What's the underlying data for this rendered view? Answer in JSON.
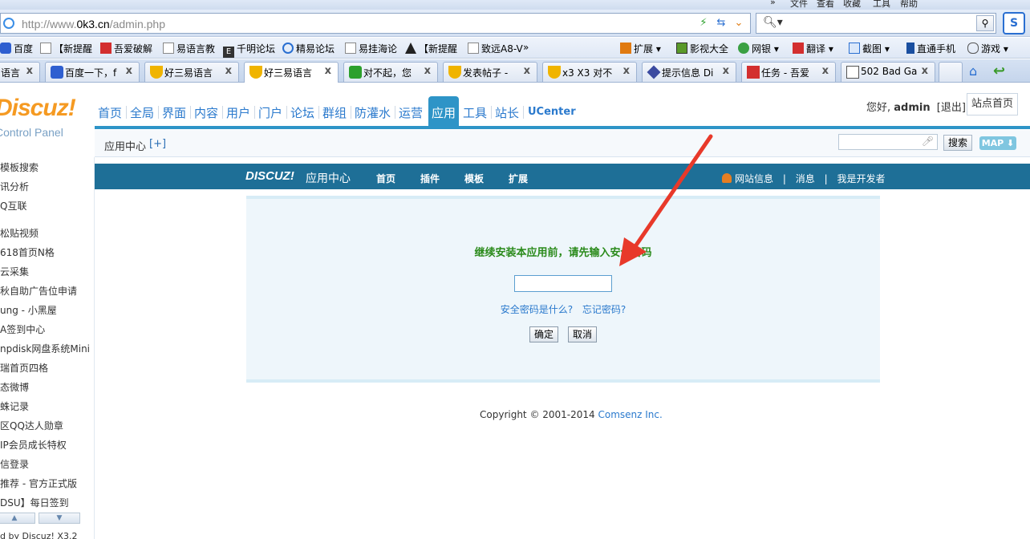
{
  "browser": {
    "menu": [
      "文件",
      "查看",
      "收藏",
      "工具",
      "帮助"
    ],
    "address": {
      "prefix": "http://www.",
      "domain": "0k3.cn",
      "path": "/admin.php"
    },
    "search_placeholder": "",
    "bookmarks": [
      {
        "label": "百度",
        "icon": "paw-icon"
      },
      {
        "label": "【新提醒",
        "icon": "page-icon"
      },
      {
        "label": "吾爱破解",
        "icon": "52pojie-icon"
      },
      {
        "label": "易语言教",
        "icon": "page-icon"
      },
      {
        "label": "千明论坛",
        "icon": "e-icon"
      },
      {
        "label": "精易论坛",
        "icon": "eye-icon"
      },
      {
        "label": "易挂海论",
        "icon": "page-icon"
      },
      {
        "label": "【新提醒",
        "icon": "spider-icon"
      },
      {
        "label": "致远A8-V",
        "icon": "page-icon"
      }
    ],
    "bookmarks_right": [
      {
        "label": "扩展",
        "icon": "grid-icon"
      },
      {
        "label": "影视大全",
        "icon": "play-icon"
      },
      {
        "label": "网银",
        "icon": "shield-icon"
      },
      {
        "label": "翻译",
        "icon": "translate-icon"
      },
      {
        "label": "截图",
        "icon": "scissors-icon"
      },
      {
        "label": "直通手机",
        "icon": "phone-icon"
      },
      {
        "label": "游戏",
        "icon": "gamepad-icon"
      }
    ],
    "tabs": [
      {
        "label": "语言",
        "icon": "page-icon"
      },
      {
        "label": "百度一下，f",
        "icon": "paw-icon"
      },
      {
        "label": "好三易语言",
        "icon": "cup-icon"
      },
      {
        "label": "好三易语言",
        "icon": "cup-icon",
        "active": true
      },
      {
        "label": "对不起，您",
        "icon": "search-green-icon"
      },
      {
        "label": "发表帖子 -",
        "icon": "cup-icon"
      },
      {
        "label": "x3 X3 对不",
        "icon": "cup-icon"
      },
      {
        "label": "提示信息 Di",
        "icon": "diamond-icon"
      },
      {
        "label": "任务 - 吾爱",
        "icon": "52pojie-icon"
      },
      {
        "label": "502 Bad Ga",
        "icon": "chart-icon"
      }
    ]
  },
  "admin": {
    "logo": "Discuz!",
    "logo_sub": "Control Panel",
    "nav": [
      "首页",
      "全局",
      "界面",
      "内容",
      "用户",
      "门户",
      "论坛",
      "群组",
      "防灌水",
      "运营",
      "应用",
      "工具",
      "站长",
      "UCenter"
    ],
    "nav_active": "应用",
    "greeting": "您好,",
    "username": "admin",
    "logout": "[退出]",
    "site_home": "站点首页",
    "sub_title": "应用中心",
    "sub_add": "[+]",
    "search_button": "搜索",
    "map_button": "MAP ⬇"
  },
  "sidebar": {
    "items": [
      "模板搜索",
      "讯分析",
      "Q互联",
      "松贴视频",
      "618首页N格",
      "云采集",
      "秋自助广告位申请",
      "ung - 小黑屋",
      "A签到中心",
      "npdisk网盘系统Mini",
      "瑞首页四格",
      "态微博",
      "蛛记录",
      "区QQ达人勋章",
      "IP会员成长特权",
      "信登录",
      "推荐 - 官方正式版",
      "DSU】每日签到"
    ],
    "footer": "d by Discuz! X3.2"
  },
  "appcenter": {
    "logo": "DISCUZ!",
    "logo_text": "应用中心",
    "nav": [
      "首页",
      "插件",
      "模板",
      "扩展"
    ],
    "right_links": [
      "网站信息",
      "消息",
      "我是开发者"
    ]
  },
  "install": {
    "message": "继续安装本应用前，请先输入安全密码",
    "password_value": "",
    "help_what": "安全密码是什么?",
    "help_forgot": "忘记密码?",
    "confirm": "确定",
    "cancel": "取消"
  },
  "footer": {
    "copyright": "Copyright © 2001-2014 ",
    "company": "Comsenz Inc."
  },
  "colors": {
    "accent": "#2e94c7",
    "app_bar": "#1e6f97",
    "message_green": "#2a8a1a",
    "arrow_red": "#e8392a"
  }
}
